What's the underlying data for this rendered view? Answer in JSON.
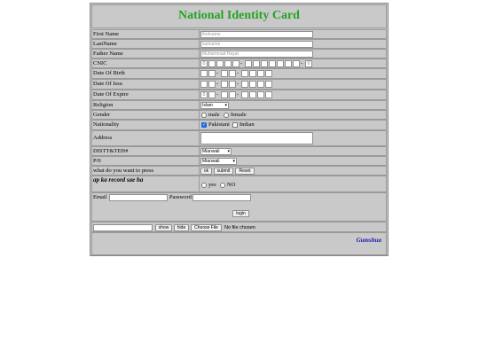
{
  "title": "National Identity Card",
  "fields": {
    "first_name": {
      "label": "First Name",
      "placeholder": "firstname"
    },
    "last_name": {
      "label": "LastName",
      "placeholder": "lastname"
    },
    "father_name": {
      "label": "Father Name",
      "placeholder": "Muhammad Hayat"
    },
    "cnic": {
      "label": "CNIC",
      "digits": [
        "0",
        "",
        "",
        "",
        "",
        "",
        "",
        "",
        "",
        "",
        "",
        "",
        "0"
      ],
      "sep": "-"
    },
    "dob": {
      "label": "Date Of Birth",
      "sep": "-"
    },
    "doi": {
      "label": "Date Of Issu",
      "sep": "-"
    },
    "doe": {
      "label": "Date Of Expire",
      "first": "0",
      "sep": "-"
    },
    "religion": {
      "label": "Religion",
      "value": "Islam"
    },
    "gender": {
      "label": "Gender",
      "opt1": "male",
      "opt2": "female"
    },
    "nationality": {
      "label": "Nationality",
      "opt1": "Pakistani",
      "opt2": "Indian"
    },
    "address": {
      "label": "Address"
    },
    "distt": {
      "label": "DISTT&TEH#",
      "value": "Mianwali"
    },
    "po": {
      "label": "P/0",
      "value": "Mianwali"
    },
    "press": {
      "label": "what do you want to press",
      "ok": "ok",
      "submit": "submit",
      "reset": "Reset"
    },
    "record": {
      "label": "ap ka record sae ha",
      "yes": "yes",
      "no": "NO"
    }
  },
  "login": {
    "email_label": "Email",
    "password_label": "Password",
    "button": "login"
  },
  "tools": {
    "show": "show",
    "hide": "hide",
    "choose": "Choose File",
    "no_file": "No file chosen"
  },
  "footer": {
    "signature": "Gumshua"
  }
}
